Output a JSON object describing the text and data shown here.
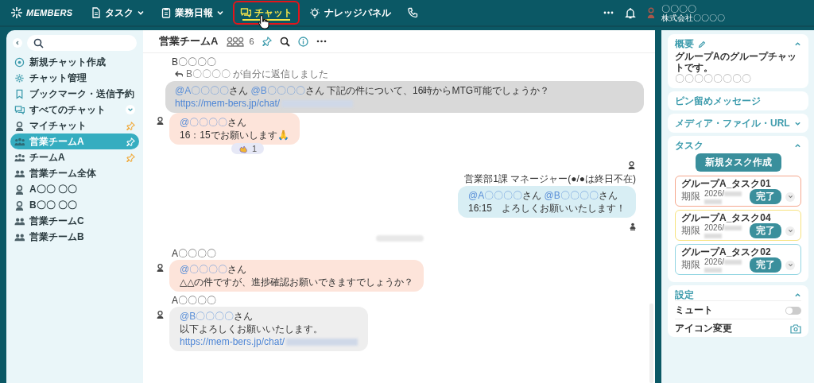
{
  "topbar": {
    "logo_text": "MEMBERS",
    "nav": [
      {
        "kind": "task",
        "label": "タスク",
        "dropdown": true,
        "selected": false,
        "highlighted": false
      },
      {
        "kind": "report",
        "label": "業務日報",
        "dropdown": true,
        "selected": false,
        "highlighted": false
      },
      {
        "kind": "chat",
        "label": "チャット",
        "selected": true,
        "highlighted": true
      },
      {
        "kind": "knowledge",
        "label": "ナレッジパネル",
        "selected": false,
        "highlighted": false
      },
      {
        "kind": "phone",
        "selected": false,
        "highlighted": false
      }
    ],
    "user": {
      "name": "〇〇〇〇",
      "company": "株式会社〇〇〇〇"
    }
  },
  "sidebar": {
    "items": [
      {
        "kind": "new",
        "label": "新規チャット作成",
        "selected": false,
        "pinned": false
      },
      {
        "kind": "manage",
        "label": "チャット管理",
        "selected": false,
        "pinned": false
      },
      {
        "kind": "bookmark",
        "label": "ブックマーク・送信予約",
        "selected": false,
        "pinned": false
      },
      {
        "kind": "all",
        "label": "すべてのチャット",
        "selected": false,
        "pinned": false,
        "expanded": false
      },
      {
        "kind": "person",
        "label": "マイチャット",
        "selected": false,
        "pinned": true
      },
      {
        "kind": "team",
        "label": "営業チームA",
        "selected": true,
        "pinned": true
      },
      {
        "kind": "team",
        "label": "チームA",
        "selected": false,
        "pinned": true
      },
      {
        "kind": "group",
        "label": "営業チーム全体",
        "selected": false,
        "pinned": false
      },
      {
        "kind": "person",
        "label": "A〇〇 〇〇",
        "selected": false,
        "pinned": false
      },
      {
        "kind": "person",
        "label": "B〇〇 〇〇",
        "selected": false,
        "pinned": false
      },
      {
        "kind": "group",
        "label": "営業チームC",
        "selected": false,
        "pinned": false
      },
      {
        "kind": "group",
        "label": "営業チームB",
        "selected": false,
        "pinned": false
      }
    ]
  },
  "chat": {
    "title": "営業チームA",
    "member_count": "6",
    "messages": [
      {
        "kind": "incoming",
        "sender": "B〇〇〇〇",
        "reply_note": "B〇〇〇〇 が自分に返信しました",
        "quote": [
          {
            "kind": "mention",
            "text": "@A〇〇〇〇"
          },
          {
            "kind": "text",
            "text": "さん "
          },
          {
            "kind": "mention",
            "text": "@B〇〇〇〇"
          },
          {
            "kind": "text",
            "text": "さん 下記の件について、16時からMTG可能でしょうか？"
          },
          {
            "kind": "link",
            "text": "https://mem-bers.jp/chat/"
          },
          {
            "kind": "blur"
          }
        ],
        "color": "#fde4da",
        "lines": [
          [
            {
              "kind": "mention",
              "text": "@〇〇〇〇"
            },
            {
              "kind": "text",
              "text": "さん"
            }
          ],
          [
            {
              "kind": "text",
              "text": "16：15でお願いします🙏"
            }
          ]
        ],
        "reaction": "1"
      },
      {
        "kind": "outgoing",
        "sender": "営業部1課 マネージャー(●/●は終日不在)",
        "color": "#d8eef4",
        "lines": [
          [
            {
              "kind": "mention",
              "text": "@A〇〇〇〇"
            },
            {
              "kind": "text",
              "text": "さん "
            },
            {
              "kind": "mention",
              "text": "@B〇〇〇〇"
            },
            {
              "kind": "text",
              "text": "さん"
            }
          ],
          [
            {
              "kind": "text",
              "text": "16:15　よろしくお願いいたします！"
            }
          ]
        ]
      },
      {
        "kind": "date"
      },
      {
        "kind": "incoming",
        "sender": "A〇〇〇〇",
        "color": "#fde4da",
        "lines": [
          [
            {
              "kind": "mention",
              "text": "@〇〇〇〇"
            },
            {
              "kind": "text",
              "text": "さん"
            }
          ],
          [
            {
              "kind": "text",
              "text": "△△の件ですが、進捗確認お願いできますでしょうか？"
            }
          ]
        ]
      },
      {
        "kind": "incoming",
        "sender": "A〇〇〇〇",
        "color": "#eeeeee",
        "lines": [
          [
            {
              "kind": "mention",
              "text": "@B〇〇〇〇"
            },
            {
              "kind": "text",
              "text": "さん"
            }
          ],
          [
            {
              "kind": "text",
              "text": "以下よろしくお願いいたします。"
            }
          ],
          [
            {
              "kind": "link",
              "text": "https://mem-bers.jp/chat/"
            },
            {
              "kind": "blur"
            }
          ]
        ]
      }
    ]
  },
  "panel": {
    "sections": [
      {
        "kind": "overview",
        "title": "概要",
        "expanded": true,
        "text": "グループAのグループチャットです。",
        "note": "〇〇〇〇〇〇〇〇"
      },
      {
        "kind": "plain",
        "title": "ピン留めメッセージ"
      },
      {
        "kind": "plain",
        "title": "メディア・ファイル・URL",
        "expanded": false
      },
      {
        "kind": "tasks",
        "title": "タスク",
        "expanded": true,
        "button": "新規タスク作成",
        "tasks": [
          {
            "title": "グループA_タスク01",
            "due_label": "期限",
            "due": "2026/",
            "action": "完了",
            "color": "#f5a88e"
          },
          {
            "title": "グループA_タスク04",
            "due_label": "期限",
            "due": "2026/",
            "action": "完了",
            "color": "#f7e27e"
          },
          {
            "title": "グループA_タスク02",
            "due_label": "期限",
            "due": "2026/",
            "action": "完了",
            "color": "#92d5e2"
          }
        ]
      },
      {
        "kind": "settings",
        "title": "設定",
        "expanded": true,
        "rows": [
          {
            "kind": "toggle",
            "label": "ミュート",
            "on": false
          },
          {
            "kind": "camera",
            "label": "アイコン変更"
          }
        ]
      }
    ]
  }
}
